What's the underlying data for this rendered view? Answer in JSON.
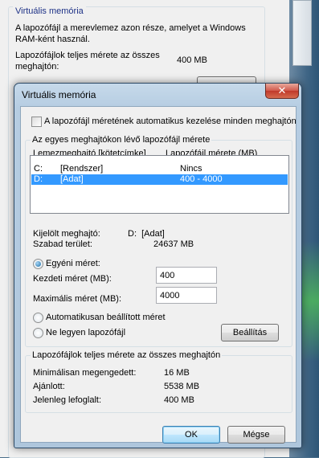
{
  "background_window": {
    "group_title": "Virtuális memória",
    "description": "A lapozófájl a merevlemez azon része, amelyet a Windows RAM-ként használ.",
    "total_label": "Lapozófájlok teljes mérete az összes meghajtón:",
    "total_value": "400 MB"
  },
  "dialog": {
    "title": "Virtuális memória",
    "close_glyph": "✕",
    "auto_manage_label": "A lapozófájl méretének automatikus kezelése minden meghajtón",
    "auto_manage_checked": false,
    "drives_group_title": "Az egyes meghajtókon lévő lapozófájl mérete",
    "columns": [
      "Lemezmeghajtó [kötetcímke]",
      "Lapozófájl mérete (MB)"
    ],
    "drives": [
      {
        "drive": "C:",
        "label": "[Rendszer]",
        "size": "Nincs",
        "selected": false
      },
      {
        "drive": "D:",
        "label": "[Adat]",
        "size": "400 - 4000",
        "selected": true
      }
    ],
    "selected_drive_label": "Kijelölt meghajtó:",
    "selected_drive_value": "D:  [Adat]",
    "free_space_label": "Szabad terület:",
    "free_space_value": "24637 MB",
    "custom_size_label": "Egyéni méret:",
    "custom_size_selected": true,
    "initial_size_label": "Kezdeti méret (MB):",
    "initial_size_value": "400",
    "max_size_label": "Maximális méret (MB):",
    "max_size_value": "4000",
    "system_managed_label": "Automatikusan beállított méret",
    "no_paging_label": "Ne legyen lapozófájl",
    "set_button": "Beállítás",
    "totals_group_title": "Lapozófájlok teljes mérete az összes meghajtón",
    "min_allowed_label": "Minimálisan megengedett:",
    "min_allowed_value": "16 MB",
    "recommended_label": "Ajánlott:",
    "recommended_value": "5538 MB",
    "currently_allocated_label": "Jelenleg lefoglalt:",
    "currently_allocated_value": "400 MB",
    "ok_button": "OK",
    "cancel_button": "Mégse"
  },
  "colors": {
    "selection": "#3399ff",
    "group_title_text": "#1e3287",
    "close_button": "#c0392b"
  }
}
